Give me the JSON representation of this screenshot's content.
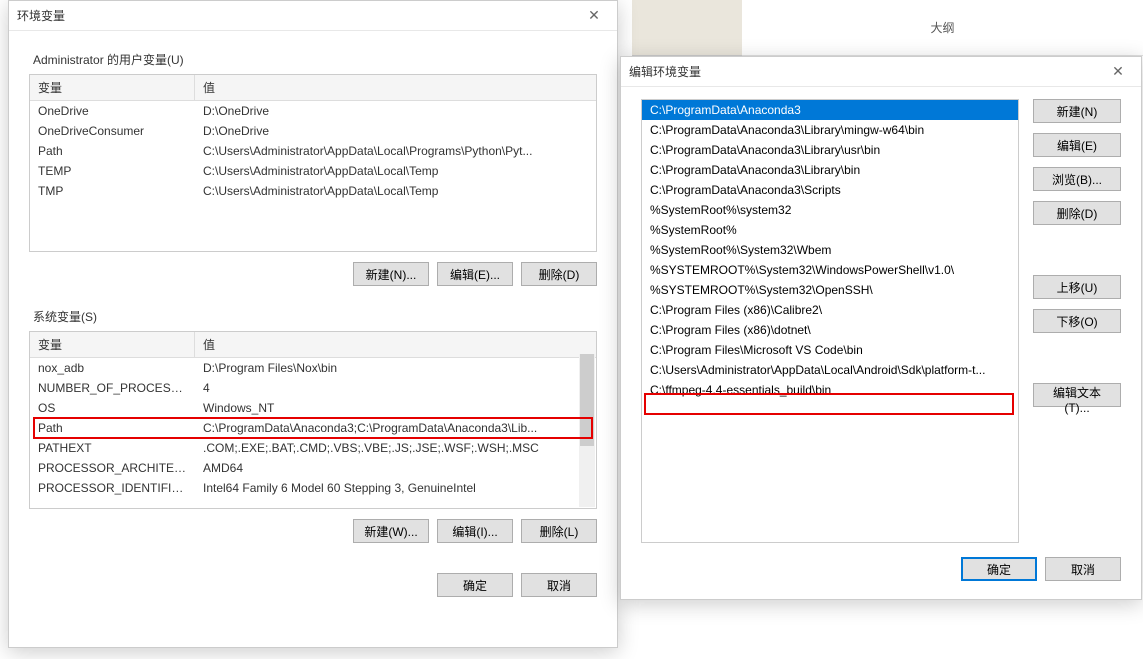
{
  "bg_tab": "大纲",
  "env_dialog": {
    "title": "环境变量",
    "user_section": "Administrator 的用户变量(U)",
    "system_section": "系统变量(S)",
    "headers": {
      "var": "变量",
      "val": "值"
    },
    "user_rows": [
      {
        "var": "OneDrive",
        "val": "D:\\OneDrive"
      },
      {
        "var": "OneDriveConsumer",
        "val": "D:\\OneDrive"
      },
      {
        "var": "Path",
        "val": "C:\\Users\\Administrator\\AppData\\Local\\Programs\\Python\\Pyt..."
      },
      {
        "var": "TEMP",
        "val": "C:\\Users\\Administrator\\AppData\\Local\\Temp"
      },
      {
        "var": "TMP",
        "val": "C:\\Users\\Administrator\\AppData\\Local\\Temp"
      }
    ],
    "system_rows": [
      {
        "var": "nox_adb",
        "val": "D:\\Program Files\\Nox\\bin"
      },
      {
        "var": "NUMBER_OF_PROCESSORS",
        "val": "4"
      },
      {
        "var": "OS",
        "val": "Windows_NT"
      },
      {
        "var": "Path",
        "val": "C:\\ProgramData\\Anaconda3;C:\\ProgramData\\Anaconda3\\Lib..."
      },
      {
        "var": "PATHEXT",
        "val": ".COM;.EXE;.BAT;.CMD;.VBS;.VBE;.JS;.JSE;.WSF;.WSH;.MSC"
      },
      {
        "var": "PROCESSOR_ARCHITECT...",
        "val": "AMD64"
      },
      {
        "var": "PROCESSOR_IDENTIFIER",
        "val": "Intel64 Family 6 Model 60 Stepping 3, GenuineIntel"
      }
    ],
    "buttons": {
      "new_n": "新建(N)...",
      "edit_e": "编辑(E)...",
      "delete_d": "删除(D)",
      "new_w": "新建(W)...",
      "edit_i": "编辑(I)...",
      "delete_l": "删除(L)",
      "ok": "确定",
      "cancel": "取消"
    }
  },
  "edit_dialog": {
    "title": "编辑环境变量",
    "items": [
      "C:\\ProgramData\\Anaconda3",
      "C:\\ProgramData\\Anaconda3\\Library\\mingw-w64\\bin",
      "C:\\ProgramData\\Anaconda3\\Library\\usr\\bin",
      "C:\\ProgramData\\Anaconda3\\Library\\bin",
      "C:\\ProgramData\\Anaconda3\\Scripts",
      "%SystemRoot%\\system32",
      "%SystemRoot%",
      "%SystemRoot%\\System32\\Wbem",
      "%SYSTEMROOT%\\System32\\WindowsPowerShell\\v1.0\\",
      "%SYSTEMROOT%\\System32\\OpenSSH\\",
      "C:\\Program Files (x86)\\Calibre2\\",
      "C:\\Program Files (x86)\\dotnet\\",
      "C:\\Program Files\\Microsoft VS Code\\bin",
      "C:\\Users\\Administrator\\AppData\\Local\\Android\\Sdk\\platform-t...",
      "C:\\ffmpeg-4.4-essentials_build\\bin"
    ],
    "buttons": {
      "new": "新建(N)",
      "edit": "编辑(E)",
      "browse": "浏览(B)...",
      "delete": "删除(D)",
      "move_up": "上移(U)",
      "move_down": "下移(O)",
      "edit_text": "编辑文本(T)...",
      "ok": "确定",
      "cancel": "取消"
    }
  }
}
